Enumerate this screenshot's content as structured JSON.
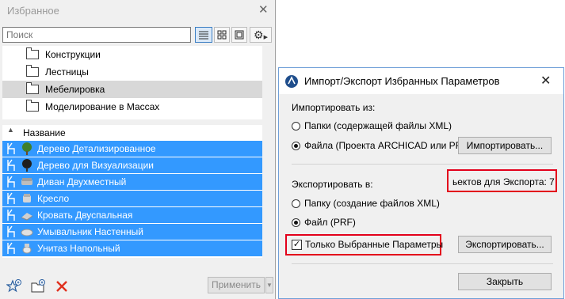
{
  "favorites": {
    "title": "Избранное",
    "close_glyph": "✕",
    "search_placeholder": "Поиск",
    "view_buttons": [
      "list-view-icon",
      "grid-view-icon",
      "large-preview-icon",
      "gear-icon"
    ],
    "folders": [
      {
        "label": "Конструкции",
        "selected": false
      },
      {
        "label": "Лестницы",
        "selected": false
      },
      {
        "label": "Мебелировка",
        "selected": true
      },
      {
        "label": "Моделирование в Массах",
        "selected": false
      }
    ],
    "list_header": "Название",
    "items": [
      {
        "label": "Дерево Детализированное",
        "icon": "tree-icon"
      },
      {
        "label": "Дерево для Визуализации",
        "icon": "tree-icon"
      },
      {
        "label": "Диван Двухместный",
        "icon": "sofa-icon"
      },
      {
        "label": "Кресло",
        "icon": "armchair-icon"
      },
      {
        "label": "Кровать Двуспальная",
        "icon": "bed-icon"
      },
      {
        "label": "Умывальник Настенный",
        "icon": "washbasin-icon"
      },
      {
        "label": "Унитаз Напольный",
        "icon": "toilet-icon"
      }
    ],
    "apply_label": "Применить",
    "selection_color": "#3399ff"
  },
  "dialog": {
    "title": "Импорт/Экспорт Избранных Параметров",
    "close_glyph": "✕",
    "import_label": "Импортировать из:",
    "import_options": [
      {
        "label": "Папки (содержащей файлы XML)",
        "checked": false
      },
      {
        "label": "Файла (Проекта ARCHICAD или PRF)",
        "checked": true
      }
    ],
    "import_button": "Импортировать...",
    "export_label": "Экспортировать в:",
    "export_count_text": "ьектов для Экспорта: 7",
    "export_options": [
      {
        "label": "Папку (создание файлов XML)",
        "checked": false
      },
      {
        "label": "Файл (PRF)",
        "checked": true
      }
    ],
    "only_selected_label": "Только Выбранные Параметры",
    "only_selected_checked": true,
    "export_button": "Экспортировать...",
    "close_button": "Закрыть",
    "highlight_color": "#e3001b"
  }
}
